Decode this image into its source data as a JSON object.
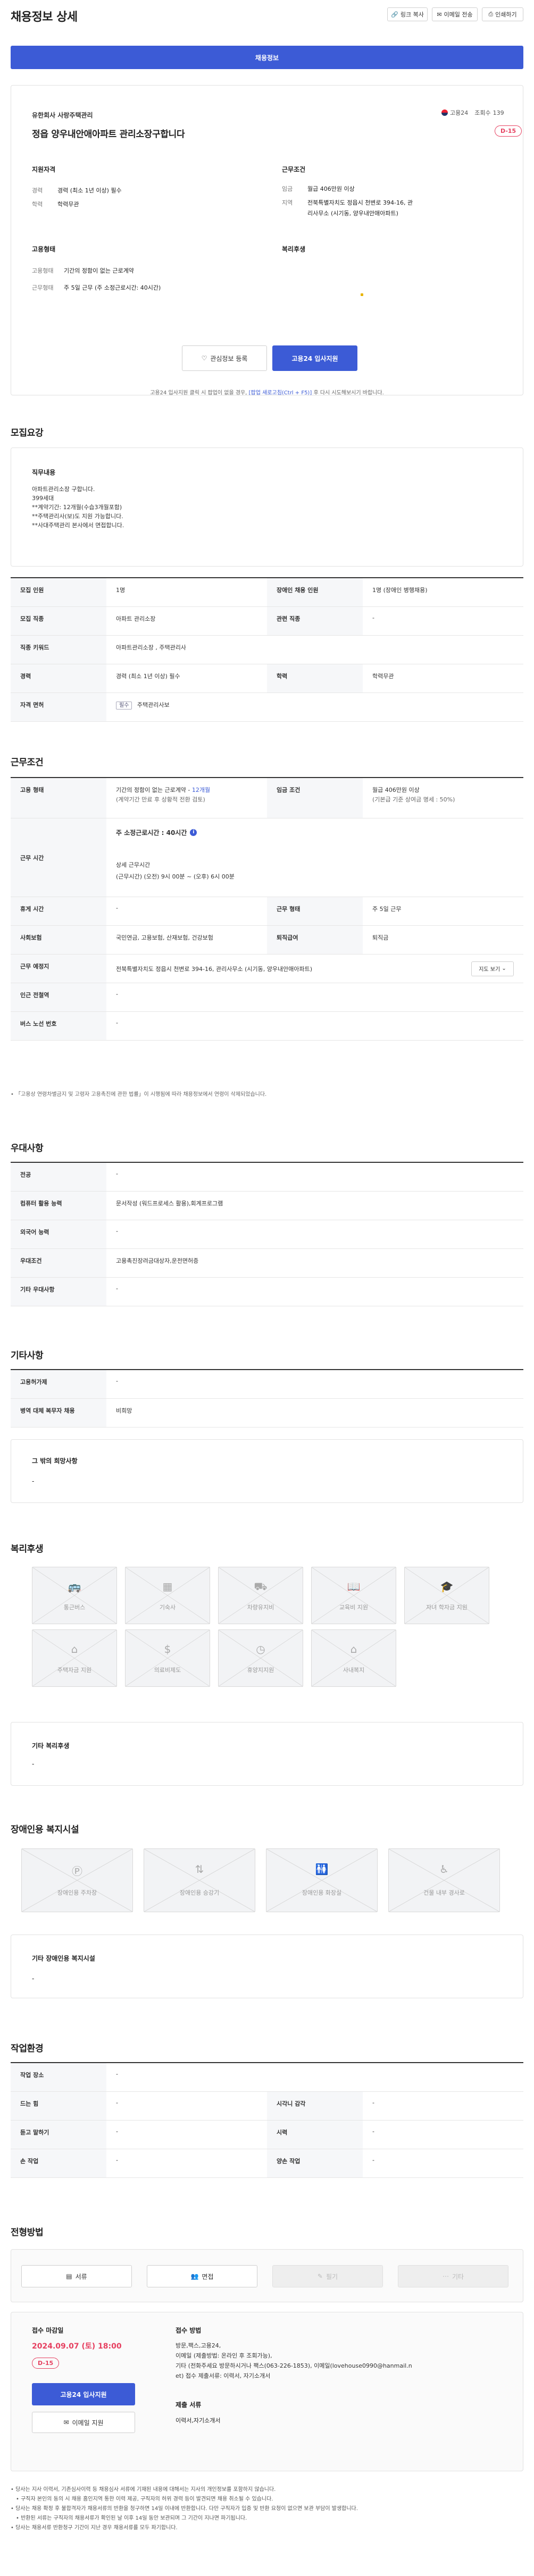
{
  "page_title": "채용정보 상세",
  "toolbar": {
    "copy": "링크 복사",
    "email": "이메일 전송",
    "print": "인쇄하기"
  },
  "tab_label": "채용정보",
  "company": {
    "name": "유한회사 사랑주택관리",
    "badge": "고용24",
    "views_label": "조회수",
    "views": "139"
  },
  "job_title": "정읍 양우내안애아파트 관리소장구합니다",
  "dday": "D-15",
  "qualifications": {
    "heading": "지원자격",
    "rows": [
      {
        "k": "경력",
        "v": "경력 (최소 1년 이상) 필수"
      },
      {
        "k": "학력",
        "v": "학력무관"
      }
    ]
  },
  "conditions": {
    "heading": "근무조건",
    "rows": [
      {
        "k": "임금",
        "v": "월급 406만원 이상"
      },
      {
        "k": "지역",
        "v": "전북특별자치도 정읍시 천변로 394-16, 관리사무소 (시기동, 양우내안애아파트)"
      }
    ]
  },
  "employment": {
    "heading": "고용형태",
    "rows": [
      {
        "k": "고용형태",
        "v": "기간의 정함이 없는 근로계약"
      },
      {
        "k": "근무형태",
        "v": "주 5일 근무 (주 소정근로시간: 40시간)"
      }
    ]
  },
  "welfare_short": {
    "heading": "복리후생"
  },
  "buttons": {
    "interest": "관심정보 등록",
    "apply": "고용24 입사지원"
  },
  "apply_note": "고용24 입사지원 클릭 시 팝업이 없을 경우,",
  "apply_note_link": "[팝업 새로고침(Ctrl + F5)]",
  "apply_note_tail": "후 다시 시도해보시기 바랍니다.",
  "recruit": {
    "heading": "모집요강",
    "duty_label": "직무내용",
    "duty_lines": [
      "아파트관리소장 구합니다.",
      "399세대",
      "**계약기간: 12개월(수습3개월포함)",
      "**주택관리사(보)도 지원 가능합니다.",
      "**사대주택관리 본사에서 면접합니다."
    ],
    "table": [
      {
        "a": "모집 인원",
        "b": "1명",
        "c": "장애인 채용 인원",
        "d": "1명 (장애인 병행채용)"
      },
      {
        "a": "모집 직종",
        "b": "아파트 관리소장",
        "c": "관련 직종",
        "d": "-"
      },
      {
        "a": "직종 키워드",
        "b": "아파트관리소장 , 주택관리사",
        "c": "",
        "d": ""
      },
      {
        "a": "경력",
        "b": "경력 (최소 1년 이상) 필수",
        "c": "학력",
        "d": "학력무관"
      },
      {
        "a": "자격 면허",
        "tag": "필수",
        "b": "주택관리사보",
        "c": "",
        "d": ""
      }
    ]
  },
  "work": {
    "heading": "근무조건",
    "emp_type_label": "고용 형태",
    "emp_type": "기간의 정함이 없는 근로계약 -",
    "emp_type_link": "12개월",
    "emp_type_sub": "(계약기간 만료 후 상황적 전환 검토)",
    "wage_label": "임금 조건",
    "wage": "월급 406만원 이상",
    "wage_sub": "(기본급 기준 상여금 명세 : 50%)",
    "hours_label": "근무 시간",
    "hours_week": "주 소정근로시간 : 40시간",
    "hours_detail_label": "상세 근무시간",
    "hours_detail": "(근무시간) (오전) 9시 00분 ~ (오후) 6시 00분",
    "holiday_label": "휴게 시간",
    "holiday": "-",
    "shift_label": "근무 형태",
    "shift": "주 5일 근무",
    "insurance_label": "사회보험",
    "insurance": "국민연금, 고용보험, 산재보험, 건강보험",
    "severance_label": "퇴직급여",
    "severance": "퇴직금",
    "place_label": "근무 예정지",
    "place": "전북특별자치도 정읍시 천변로 394-16, 관리사무소 (시기동, 양우내안애아파트)",
    "map_btn": "지도 보기",
    "station_label": "인근 전철역",
    "station": "-",
    "bus_label": "버스 노선 번호",
    "bus": "-",
    "footnote": "「고용상 연령차별금지 및 고령자 고용촉진에 관한 법률」이 시행됨에 따라 채용정보에서 연령이 삭제되었습니다."
  },
  "preference": {
    "heading": "우대사항",
    "rows": [
      {
        "k": "전공",
        "v": "-"
      },
      {
        "k": "컴퓨터 활용 능력",
        "v": "문서작성 (워드프로세스 활용),회계프로그램"
      },
      {
        "k": "외국어 능력",
        "v": "-"
      },
      {
        "k": "우대조건",
        "v": "고용촉진장려금대상자,운전면허증"
      },
      {
        "k": "기타 우대사항",
        "v": "-"
      }
    ]
  },
  "etc": {
    "heading": "기타사항",
    "rows": [
      {
        "k": "고용허가제",
        "v": "-"
      },
      {
        "k": "병역 대체 복무자 채용",
        "v": "비희망"
      }
    ],
    "extra_label": "그 밖의 희망사항",
    "extra": "-"
  },
  "welfare": {
    "heading": "복리후생",
    "items": [
      {
        "icon": "bus-icon",
        "label": "통근버스"
      },
      {
        "icon": "dormitory-icon",
        "label": "기숙사"
      },
      {
        "icon": "vehicle-icon",
        "label": "차량유지비"
      },
      {
        "icon": "book-icon",
        "label": "교육비 지원"
      },
      {
        "icon": "graduation-cap-icon",
        "label": "자녀 학자금 지원"
      },
      {
        "icon": "house-icon",
        "label": "주택자금 지원"
      },
      {
        "icon": "money-icon",
        "label": "의료비제도"
      },
      {
        "icon": "clock-icon",
        "label": "휴양지지원"
      },
      {
        "icon": "home-icon",
        "label": "사내복지"
      }
    ],
    "other_label": "기타 복리후생",
    "other": "-"
  },
  "disability": {
    "heading": "장애인용 복지시설",
    "items": [
      {
        "icon": "parking-icon",
        "label": "장애인용 주차장"
      },
      {
        "icon": "elevator-icon",
        "label": "장애인용 승강기"
      },
      {
        "icon": "restroom-icon",
        "label": "장애인용 화장실"
      },
      {
        "icon": "ramp-icon",
        "label": "건물 내부 경사로"
      }
    ],
    "other_label": "기타 장애인용 복지시설",
    "other": "-"
  },
  "environment": {
    "heading": "작업환경",
    "rows": [
      {
        "a": "작업 장소",
        "b": "-",
        "c": "",
        "d": ""
      },
      {
        "a": "드는 힘",
        "b": "-",
        "c": "시각니 감각",
        "d": "-"
      },
      {
        "a": "듣고 말하기",
        "b": "-",
        "c": "시력",
        "d": "-"
      },
      {
        "a": "손 작업",
        "b": "-",
        "c": "양손 작업",
        "d": "-"
      }
    ]
  },
  "selection": {
    "heading": "전형방법",
    "steps": [
      {
        "label": "서류",
        "active": true
      },
      {
        "label": "면접",
        "active": true
      },
      {
        "label": "필기",
        "active": false
      },
      {
        "label": "기타",
        "active": false
      }
    ]
  },
  "deadline": {
    "label": "접수 마감일",
    "date": "2024.09.07 (토) 18:00",
    "dday": "D-15",
    "apply": "고용24 입사지원",
    "email": "이메일 지원",
    "method_label": "접수 방법",
    "method_lines": [
      "방문,팩스,고용24,",
      "이메일 (제출방법: 온라인 후 조회가능),",
      "기타 (전화주세요 방문하시거나 팩스(063-226-1853), 이메일(lovehouse0990@hanmail.n",
      "et) 접수 제출서류: 이력서, 자기소개서"
    ],
    "docs_label": "제출 서류",
    "docs": "이력서,자기소개서"
  },
  "notices": [
    "당사는 지사 이력서, 기존심사이력 등 채용심사 서류에 기재된 내용에 대해서는 지사의 개인정보를 포함하지 않습니다.",
    "구직자 본인의 동의 시 채용 홈인지역 통한 이력 제공, 구직자의 허위 경력 등이 발견되면 채용 취소될 수 있습니다.",
    "당사는 채용 확정 후 불합격자가 채용서류의 반환을 청구하면 14일 이내에 반환합니다. 다만 구직자가 입증 및 반환 요청이 없으면 보관 부담이 발생합니다.",
    "반환된 서류는 구직자의 채용서류가 확인된 날 이후 14일 동안 보관되며 그 기간이 지나면 파기됩니다.",
    "당사는 채용서류 반환청구 기간이 지난 경우 채용서류를 모두 파기합니다."
  ]
}
